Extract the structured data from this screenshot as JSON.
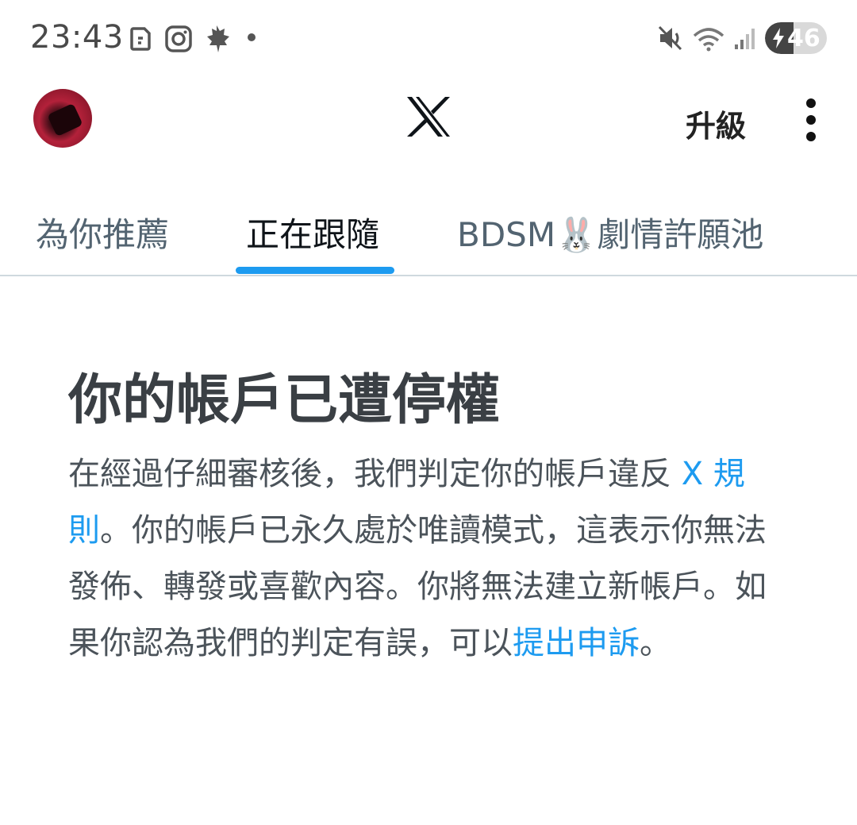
{
  "status_bar": {
    "time": "23:43",
    "battery": 46,
    "icons": [
      "notification-app-icon",
      "instagram-icon",
      "maple-leaf-icon",
      "more-dot-icon",
      "mute-icon",
      "wifi-icon",
      "signal-icon",
      "battery-charging-icon"
    ]
  },
  "header": {
    "logo": "X",
    "upgrade_label": "升級",
    "menu_icon": "more-vertical-icon"
  },
  "tabs": [
    {
      "label": "為你推薦",
      "active": false
    },
    {
      "label": "正在跟隨",
      "active": true
    },
    {
      "label": "BDSM🐰劇情許願池",
      "active": false
    }
  ],
  "notice": {
    "title": "你的帳戶已遭停權",
    "body_part1": "在經過仔細審核後，我們判定你的帳戶違反 ",
    "rules_link": "X 規則",
    "body_part2": "。你的帳戶已永久處於唯讀模式，這表示你無法發佈、轉發或喜歡內容。你將無法建立新帳戶。如果你認為我們的判定有誤，可以",
    "appeal_link": "提出申訴",
    "body_part3": "。"
  },
  "colors": {
    "accent": "#1d9bf0",
    "tab_inactive": "#536471",
    "divider": "#cfd9de"
  }
}
